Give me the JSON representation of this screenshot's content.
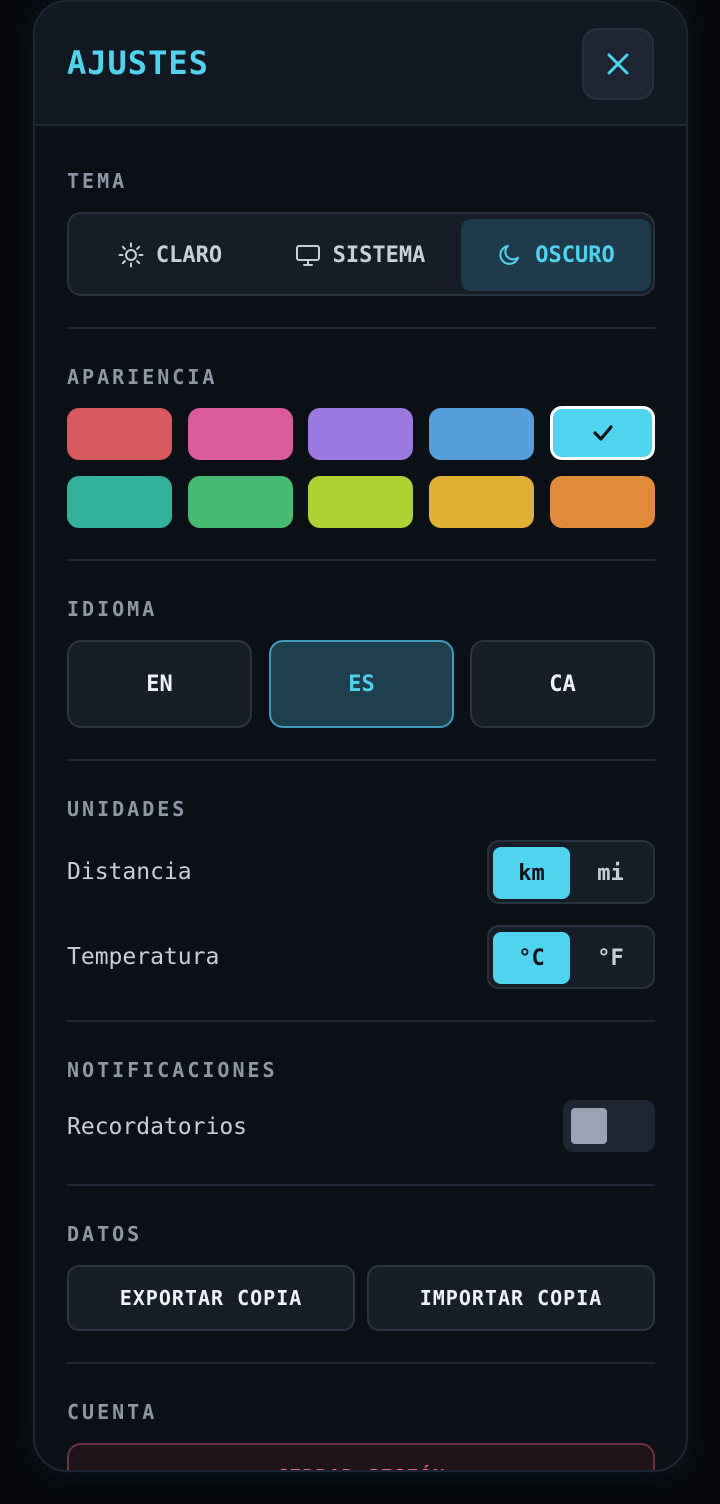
{
  "header": {
    "title": "AJUSTES",
    "close_icon": "close-icon"
  },
  "sections": {
    "theme": "TEMA",
    "appearance": "APARIENCIA",
    "language": "IDIOMA",
    "units": "UNIDADES",
    "notifications": "NOTIFICACIONES",
    "data": "DATOS",
    "account": "CUENTA"
  },
  "theme": {
    "options": [
      {
        "label": "CLARO",
        "icon": "sun-icon"
      },
      {
        "label": "SISTEMA",
        "icon": "monitor-icon"
      },
      {
        "label": "OSCURO",
        "icon": "moon-icon"
      }
    ],
    "selected": "OSCURO"
  },
  "appearance": {
    "colors": [
      "#d95a5e",
      "#dc5c9b",
      "#9a7ae0",
      "#579fdc",
      "#4fd4ef",
      "#32b29a",
      "#48bb72",
      "#afd032",
      "#e0b035",
      "#e08a3a"
    ],
    "selected_index": 4,
    "check_icon": "check-icon"
  },
  "language": {
    "options": [
      "EN",
      "ES",
      "CA"
    ],
    "selected": "ES"
  },
  "units": {
    "distance": {
      "label": "Distancia",
      "options": [
        "km",
        "mi"
      ],
      "selected": "km"
    },
    "temperature": {
      "label": "Temperatura",
      "options": [
        "°C",
        "°F"
      ],
      "selected": "°C"
    }
  },
  "notifications": {
    "reminders": {
      "label": "Recordatorios",
      "enabled": false
    }
  },
  "data": {
    "export_label": "EXPORTAR COPIA",
    "import_label": "IMPORTAR COPIA"
  },
  "account": {
    "logout_label": "CERRAR SESIÓN"
  },
  "colors": {
    "accent": "#4fd4ef",
    "panel": "#0b0f16",
    "danger": "#e06a82"
  }
}
